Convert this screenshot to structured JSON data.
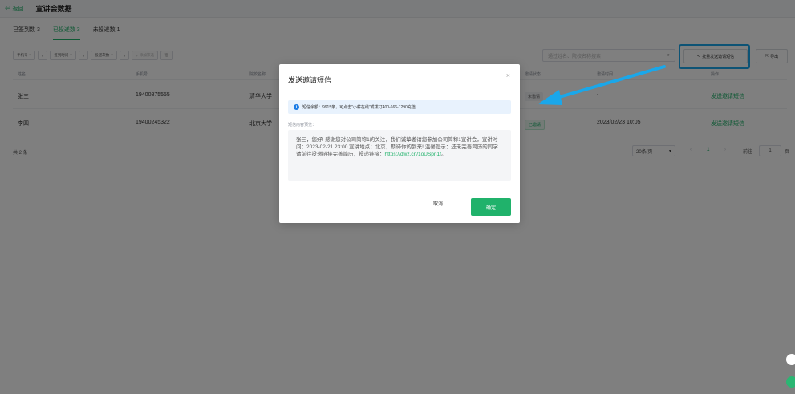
{
  "header": {
    "back_label": "返回",
    "title": "宣讲会数据"
  },
  "tabs": [
    {
      "label": "已签到数 3"
    },
    {
      "label": "已投递数 3"
    },
    {
      "label": "未投递数 1"
    }
  ],
  "active_tab": 1,
  "filters": [
    {
      "label": "手机号"
    },
    {
      "label": "签到时间"
    },
    {
      "label": "投递次数"
    },
    {
      "label": "添加筛选"
    }
  ],
  "search": {
    "placeholder": "通过姓名、院校名称搜索"
  },
  "toolbar": {
    "batch_label": "批量发送邀请短信",
    "export_label": "导出"
  },
  "table": {
    "columns": [
      "姓名",
      "手机号",
      "院校名称",
      "邀请状态",
      "邀请时间",
      "操作"
    ],
    "rows": [
      {
        "name": "张三",
        "phone": "19400875555",
        "school": "清华大学",
        "status": "未邀请",
        "time": "-",
        "action": "发送邀请短信"
      },
      {
        "name": "李四",
        "phone": "19400245322",
        "school": "北京大学",
        "status": "已邀请",
        "time": "2023/02/23 10:05",
        "action": "发送邀请短信"
      }
    ]
  },
  "pagination": {
    "total": "共 2 条",
    "page_size": "20条/页",
    "current_page": "1",
    "goto_label": "前往",
    "goto_value": "1",
    "page_unit": "页"
  },
  "dialog": {
    "title": "发送邀请短信",
    "info": "短信余额：9915条，可点击\"小薪在线\"或拨打400-666-1290充值",
    "content_label": "短信内容预览：",
    "content": "张三，您好! 感谢您对公司简称1的关注，我们诚挚邀请您参加公司简称1宣讲会，宣讲时间：2023-02-21 23:00 宣讲地点：北京，期待你的到来! 温馨提示：还未完善简历的同学请前往投递链接完善简历，投递链接：",
    "link": "https://dwz.cn/1oUSpn1f",
    "content_end": "。",
    "cancel_label": "取消",
    "ok_label": "确定"
  },
  "colors": {
    "accent": "#20b26b",
    "annotation": "#1aa7ea",
    "info_bg": "#e8f2fd"
  }
}
